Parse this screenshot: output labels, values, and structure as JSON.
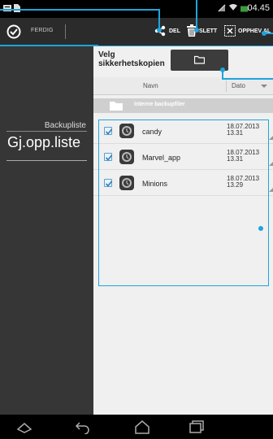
{
  "status_bar": {
    "time": "04.45"
  },
  "action_bar": {
    "done_label": "FERDIG",
    "share_label": "DEL",
    "delete_label": "SLETT",
    "unselect_all_label": "OPPHEV AL"
  },
  "left_pane": {
    "heading": "Backupliste",
    "current_item": "Gj.opp.liste"
  },
  "right_pane": {
    "title": "Velg sikkerhetskopien",
    "columns": {
      "name": "Navn",
      "date": "Dato"
    },
    "group_label": "Interne backupfiler",
    "items": [
      {
        "name": "candy",
        "date": "18.07.2013",
        "time": "13.31",
        "checked": true
      },
      {
        "name": "Marvel_app",
        "date": "18.07.2013",
        "time": "13.31",
        "checked": true
      },
      {
        "name": "Minions",
        "date": "18.07.2013",
        "time": "13.29",
        "checked": true
      }
    ]
  },
  "accent_color": "#1fa4dc"
}
